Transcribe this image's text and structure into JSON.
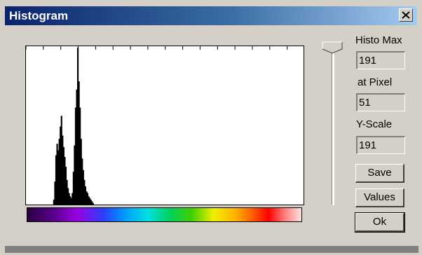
{
  "window": {
    "title": "Histogram",
    "close_icon": "close-x-icon",
    "colors": {
      "title_start": "#0a246a",
      "title_end": "#a6caf0",
      "face": "#d4d0c8"
    }
  },
  "panel": {
    "histo_max_label": "Histo Max",
    "histo_max_value": "191",
    "at_pixel_label": "at Pixel",
    "at_pixel_value": "51",
    "yscale_label": "Y-Scale",
    "yscale_value": "191"
  },
  "buttons": {
    "save": "Save",
    "values": "Values",
    "ok": "Ok"
  },
  "slider": {
    "position": 0.0
  },
  "chart_data": {
    "type": "area",
    "title": "",
    "xlabel": "",
    "ylabel": "",
    "xlim": [
      0,
      255
    ],
    "ylim": [
      0,
      191
    ],
    "x": [
      24,
      25,
      26,
      27,
      28,
      29,
      30,
      31,
      32,
      33,
      34,
      35,
      36,
      37,
      38,
      39,
      40,
      41,
      42,
      43,
      44,
      45,
      46,
      47,
      48,
      49,
      50,
      51,
      52,
      53,
      54,
      55,
      56,
      57,
      58,
      59,
      60,
      61,
      62,
      63,
      64
    ],
    "values": [
      0,
      6,
      28,
      60,
      74,
      66,
      80,
      95,
      108,
      84,
      70,
      58,
      46,
      30,
      20,
      14,
      10,
      8,
      14,
      40,
      72,
      118,
      140,
      191,
      150,
      118,
      80,
      56,
      42,
      30,
      22,
      16,
      14,
      10,
      8,
      6,
      4,
      2,
      0,
      0,
      0
    ],
    "grid": false,
    "colorbar": "spectrum"
  }
}
